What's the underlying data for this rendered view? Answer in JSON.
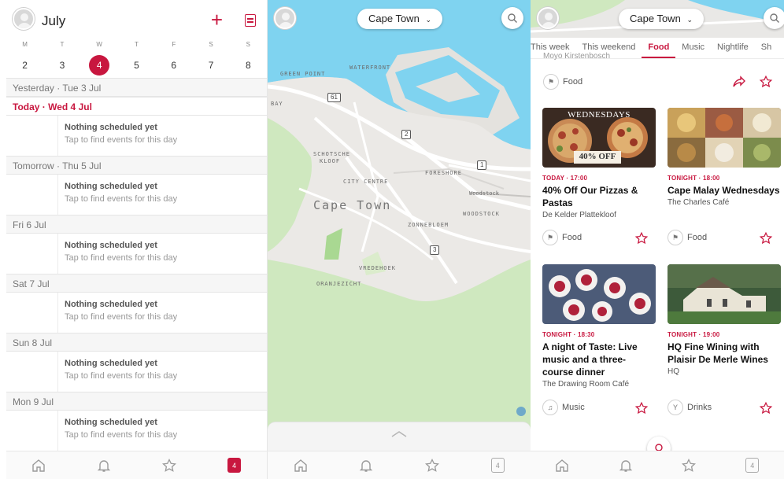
{
  "calendar": {
    "month": "July",
    "weekdays": [
      "M",
      "T",
      "W",
      "T",
      "F",
      "S",
      "S"
    ],
    "dates": [
      "2",
      "3",
      "4",
      "5",
      "6",
      "7",
      "8"
    ],
    "selected_date": "4",
    "empty_title": "Nothing scheduled yet",
    "empty_hint": "Tap to find events for this day",
    "days": [
      {
        "label": "Yesterday · Tue 3 Jul"
      },
      {
        "label": "Today · Wed 4 Jul"
      },
      {
        "label": "Tomorrow · Thu 5 Jul"
      },
      {
        "label": "Fri 6 Jul"
      },
      {
        "label": "Sat 7 Jul"
      },
      {
        "label": "Sun 8 Jul"
      },
      {
        "label": "Mon 9 Jul"
      }
    ],
    "nav_badge": "4"
  },
  "map": {
    "city_selector": "Cape Town",
    "labels": {
      "green_point": "GREEN POINT",
      "waterfront": "WATERFRONT",
      "bay": "BAY",
      "schotsche": "SCHOTSCHE",
      "kloof": "KLOOF",
      "city_centre": "CITY CENTRE",
      "foreshore": "FORESHORE",
      "woodstock_small": "Woodstock",
      "city": "Cape Town",
      "woodstock": "WOODSTOCK",
      "zonnebloem": "ZONNEBLOEM",
      "vredehoek": "VREDEHOEK",
      "oranjezicht": "ORANJEZICHT"
    },
    "shields": [
      "61",
      "2",
      "1",
      "3"
    ],
    "nav_badge": "4"
  },
  "feed": {
    "city_selector": "Cape Town",
    "tabs": [
      "This week",
      "This weekend",
      "Food",
      "Music",
      "Nightlife",
      "Sh"
    ],
    "active_tab": "Food",
    "cut_venue": "Moyo Kirstenbosch",
    "top_category": "Food",
    "cards": [
      {
        "time": "TODAY · 17:00",
        "title": "40% Off Our Pizzas & Pastas",
        "venue": "De Kelder Plattekloof",
        "category": "Food",
        "image_banner": "WEDNESDAYS",
        "image_tag": "40% OFF"
      },
      {
        "time": "TONIGHT · 18:00",
        "title": "Cape Malay Wednesdays",
        "venue": "The Charles Café",
        "category": "Food"
      },
      {
        "time": "TONIGHT · 18:30",
        "title": "A night of Taste: Live music and a three-course dinner",
        "venue": "The Drawing Room Café",
        "category": "Music"
      },
      {
        "time": "TONIGHT · 19:00",
        "title": "HQ Fine Wining with Plaisir De Merle Wines",
        "venue": "HQ",
        "category": "Drinks"
      }
    ],
    "nav_badge": "4"
  },
  "colors": {
    "accent": "#c8173f",
    "water": "#7fd3f0",
    "park": "#cfe8bf"
  }
}
